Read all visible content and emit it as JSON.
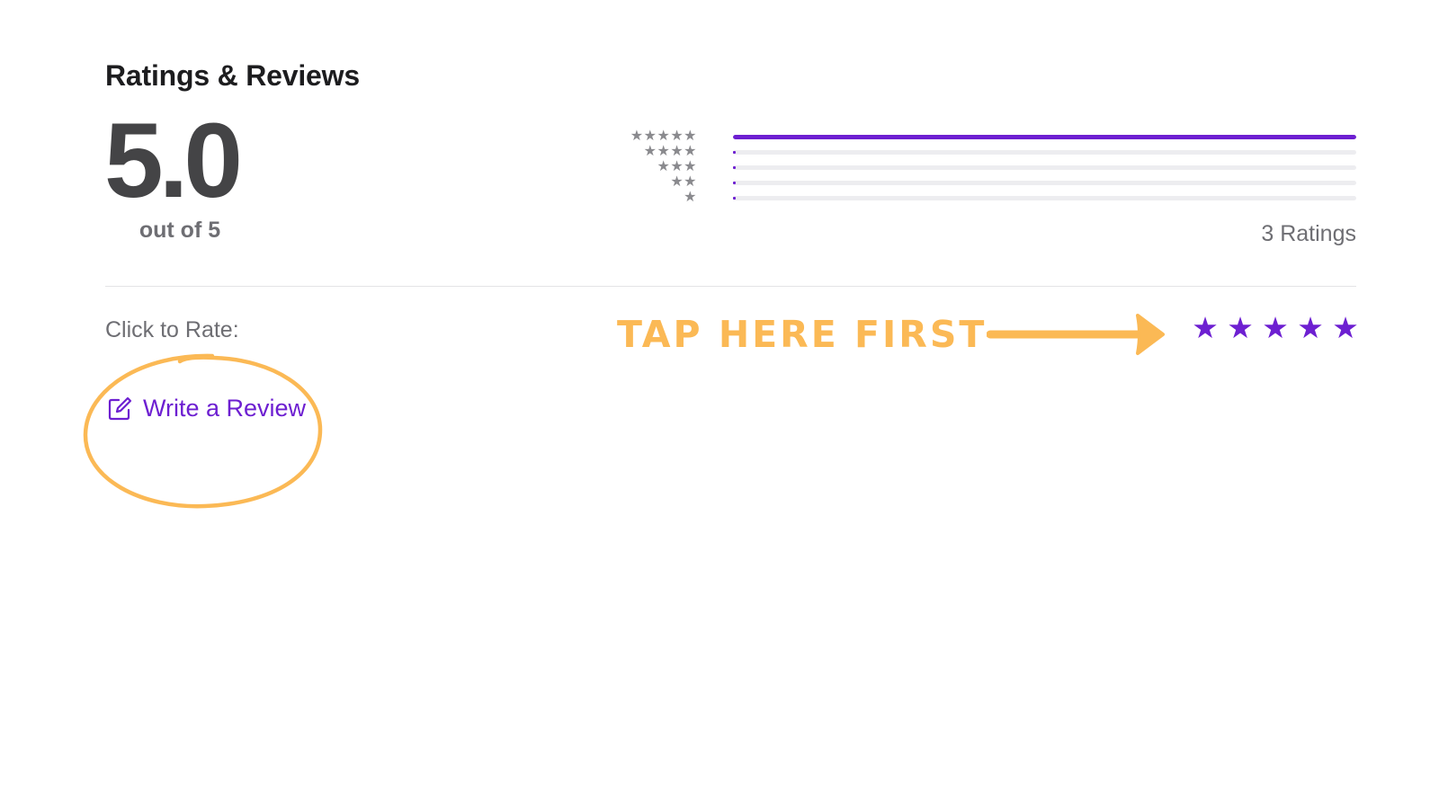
{
  "section": {
    "title": "Ratings & Reviews"
  },
  "summary": {
    "score": "5.0",
    "out_of": "out of 5",
    "ratings_count": "3 Ratings"
  },
  "histogram": {
    "rows": [
      {
        "stars": "★★★★★",
        "fraction": 1.0
      },
      {
        "stars": "★★★★",
        "fraction": 0.0
      },
      {
        "stars": "★★★",
        "fraction": 0.0
      },
      {
        "stars": "★★",
        "fraction": 0.0
      },
      {
        "stars": "★",
        "fraction": 0.0
      }
    ]
  },
  "rate": {
    "label": "Click to Rate:",
    "star_glyph": "★",
    "star_count": 5
  },
  "write_review": {
    "label": "Write a Review",
    "icon": "compose-icon"
  },
  "annotation": {
    "text": "TAP HERE FIRST",
    "color": "#fbb955"
  },
  "colors": {
    "accent": "#6d1fd1",
    "annotation": "#fbb955"
  }
}
